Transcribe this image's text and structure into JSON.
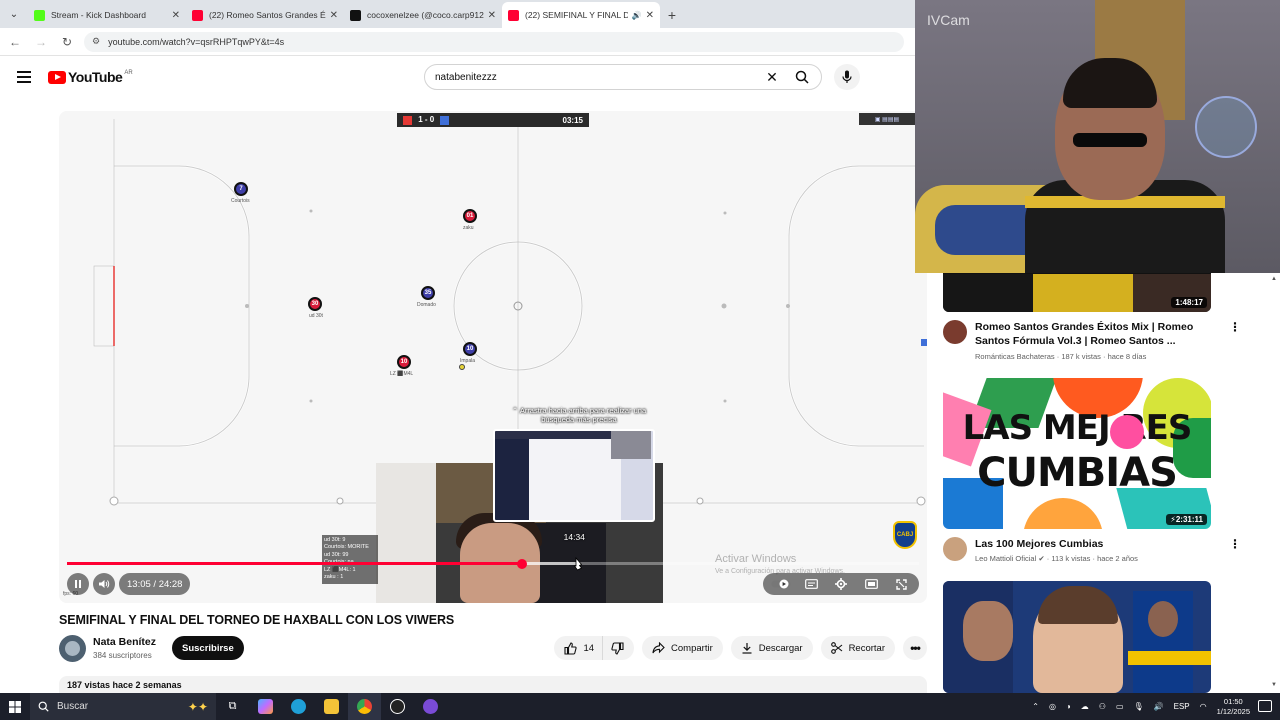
{
  "browser": {
    "tabs": [
      {
        "title": "Stream - Kick Dashboard",
        "favicon_color": "#53fc18",
        "active": false
      },
      {
        "title": "(22) Romeo Santos Grandes Éxi",
        "favicon_color": "#ff0033",
        "active": false
      },
      {
        "title": "cocoxenelzee (@coco.carp912)",
        "favicon_color": "#111111",
        "active": false
      },
      {
        "title": "(22) SEMIFINAL Y FINAL DE",
        "favicon_color": "#ff0033",
        "active": true
      }
    ],
    "url": "youtube.com/watch?v=qsrRHPTqwPY&t=4s"
  },
  "youtube": {
    "country_code": "AR",
    "logo_text": "YouTube",
    "search_value": "natabenitezzz"
  },
  "player": {
    "scoreboard": {
      "score": "1 - 0",
      "clock": "03:15",
      "red": "#e53935",
      "blue": "#3f6fd8"
    },
    "players": [
      {
        "num": "7",
        "name": "Courtois",
        "team": "blue"
      },
      {
        "num": "01",
        "name": "zaku",
        "team": "red"
      },
      {
        "num": "30",
        "name": "ud 30t",
        "team": "red"
      },
      {
        "num": "35",
        "name": "Domado",
        "team": "blue"
      },
      {
        "num": "10",
        "name": "LZ ⬛M4L",
        "team": "red"
      },
      {
        "num": "10",
        "name": "Impala",
        "team": "blue"
      }
    ],
    "hint_text": "⌃ Arrastra hacia arriba para realizar una búsqueda más precisa",
    "overlay_stats": [
      "ud 30t: 9",
      "Courtois: MORITE",
      "ud 30t: 99",
      "Courtois: na",
      "LZ ⬛M4L: 1",
      "zaku : 1"
    ],
    "watermark_title": "Activar Windows",
    "watermark_sub": "Ve a Configuración para activar Windows.",
    "club_badge_text": "CABJ",
    "current_time": "13:05",
    "duration": "24:28",
    "time_display": "13:05 / 24:28",
    "hover_time": "14:34",
    "progress": 0.534,
    "buffered": 0.6,
    "hover_fraction": 0.597,
    "corner_label": "fps: 60"
  },
  "video": {
    "title": "SEMIFINAL Y FINAL DEL TORNEO DE HAXBALL CON LOS VIWERS",
    "channel": "Nata Benítez",
    "subscribers": "384 suscriptores",
    "subscribe_label": "Suscribirse",
    "likes": "14",
    "share_label": "Compartir",
    "download_label": "Descargar",
    "clip_label": "Recortar",
    "views_date": "187 vistas  hace 2 semanas"
  },
  "webcam_overlay": {
    "label": "IVCam"
  },
  "recommendations": [
    {
      "duration": "1:48:17",
      "title": "Romeo Santos Grandes Éxitos Mix | Romeo Santos Fórmula Vol.3 | Romeo Santos ...",
      "channel": "Románticas Bachateras",
      "meta": "187 k vistas · hace 8 días",
      "avatar_color": "#7a3b2e"
    },
    {
      "duration": "2:31:11",
      "title": "Las 100 Mejores Cumbias",
      "channel": "Leo Mattioli Oficial",
      "meta": "113 k vistas · hace 2 años",
      "thumb_line1": "LAS MEJ  RES",
      "thumb_line2": "CUMBIAS",
      "avatar_color": "#c9a17e"
    }
  ],
  "taskbar": {
    "search_label": "Buscar",
    "lang": "ESP",
    "time": "01:50",
    "date": "1/12/2025"
  }
}
